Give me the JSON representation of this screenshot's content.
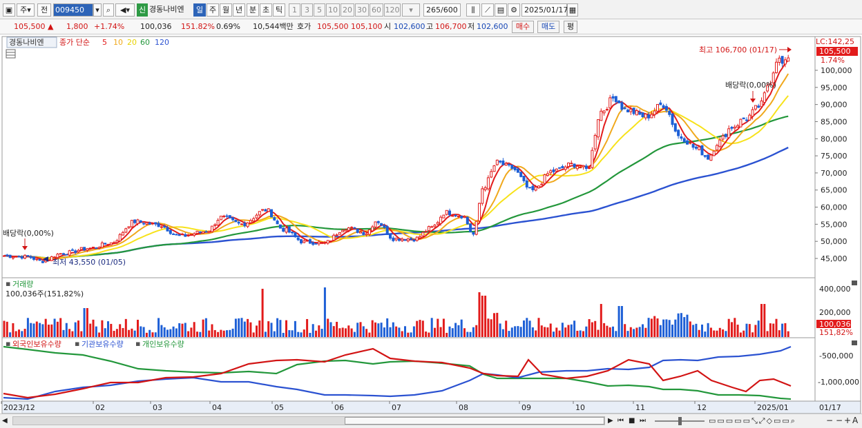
{
  "toolbar": {
    "market_select": "주",
    "pre_select": "전",
    "code": "009450",
    "sin_badge": "신",
    "stock_name": "경동나비엔",
    "periods": [
      "일",
      "주",
      "월",
      "년",
      "분",
      "초",
      "틱"
    ],
    "active_period": "일",
    "minutes": [
      "1",
      "3",
      "5",
      "10",
      "20",
      "30",
      "60",
      "120"
    ],
    "count_value": "265",
    "count_total": "/600",
    "date": "2025/01/17"
  },
  "quote": {
    "price": "105,500",
    "change": "1,800",
    "change_pct": "+1.74%",
    "volume": "100,036",
    "volume_ratio": "151.82%",
    "turnover_pct": "0.69%",
    "amount": "10,544백만",
    "hoga_label": "호가",
    "ask": "105,500",
    "bid": "105,100",
    "open_label": "시",
    "open": "102,600",
    "high_label": "고",
    "high": "106,700",
    "low_label": "저",
    "low": "102,600",
    "buy_btn": "매수",
    "sell_btn": "매도",
    "eval_btn": "평"
  },
  "price_panel": {
    "stock_tag": "경동나비엔",
    "legend_prefix": "종가 단순",
    "ma_labels": [
      {
        "label": "5",
        "color": "#e21b1b"
      },
      {
        "label": "10",
        "color": "#f0a81c"
      },
      {
        "label": "20",
        "color": "#f7e21a"
      },
      {
        "label": "60",
        "color": "#23973b"
      },
      {
        "label": "120",
        "color": "#2b52d1"
      }
    ],
    "lc_label": "LC:142,25",
    "last_price_tag": "105,500",
    "last_pct_tag": "1.74%",
    "high_annotation": "최고 106,700 (01/17)",
    "low_annotation": "최저 43,550 (01/05)",
    "dividend_left": "배당락(0,00%)",
    "dividend_right": "배당락(0,00%)",
    "y_ticks": [
      "100,000",
      "95,000",
      "90,000",
      "85,000",
      "80,000",
      "75,000",
      "70,000",
      "65,000",
      "60,000",
      "55,000",
      "50,000",
      "45,000"
    ]
  },
  "volume_panel": {
    "title": "거래량",
    "info": "100,036주(151,82%)",
    "y_ticks": [
      "400,000",
      "200,000"
    ],
    "last_tag": "100,036",
    "pct_tag": "151,82%"
  },
  "holdings_panel": {
    "legend": [
      {
        "label": "외국인보유수량",
        "color": "#d21414"
      },
      {
        "label": "기관보유수량",
        "color": "#2b52d1"
      },
      {
        "label": "개인보유수량",
        "color": "#23973b"
      }
    ],
    "y_ticks": [
      "-500,000",
      "-1,000,000"
    ]
  },
  "x_axis": {
    "labels": [
      "2023/12",
      "02",
      "03",
      "04",
      "05",
      "06",
      "07",
      "08",
      "09",
      "10",
      "11",
      "12",
      "2025/01"
    ],
    "right_label": "01/17"
  },
  "colors": {
    "up": "#e21b1b",
    "down": "#1d5fd6",
    "accent": "#2d64b8"
  }
}
